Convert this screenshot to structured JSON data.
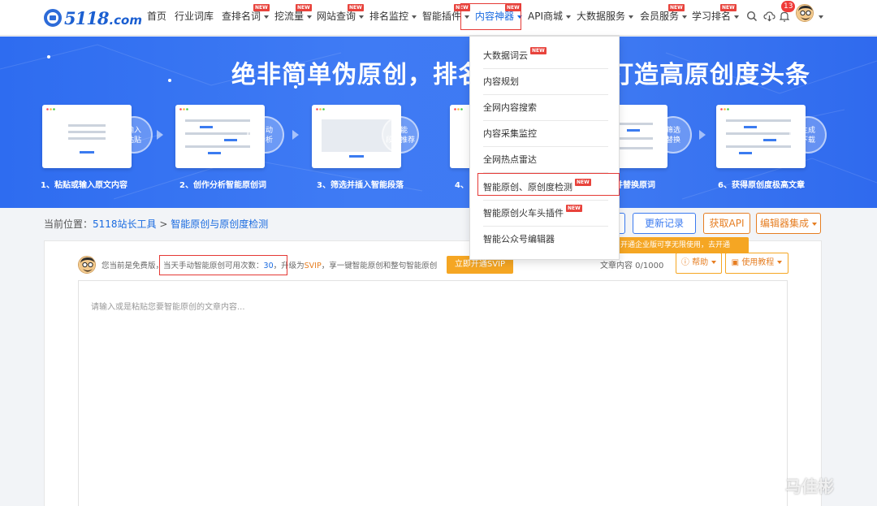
{
  "logo": {
    "text": "5118",
    "suffix": ".com"
  },
  "nav": {
    "items": [
      {
        "label": "首页"
      },
      {
        "label": "行业词库"
      },
      {
        "label": "查排名词",
        "new": "NEW"
      },
      {
        "label": "挖流量",
        "new": "NEW"
      },
      {
        "label": "网站查询",
        "new": "NEW"
      },
      {
        "label": "排名监控"
      },
      {
        "label": "智能插件",
        "new": "NEW"
      },
      {
        "label": "内容神器",
        "new": "NEW"
      },
      {
        "label": "API商城"
      },
      {
        "label": "大数据服务"
      },
      {
        "label": "会员服务",
        "new": "NEW"
      },
      {
        "label": "学习排名",
        "new": "NEW"
      }
    ],
    "notification_count": "13"
  },
  "banner": {
    "title": "绝非简单伪原创，排名利器，轻松打造高原创度头条",
    "steps": [
      {
        "label": "1、粘贴或输入原文内容",
        "circle": [
          "输入",
          "粘贴"
        ]
      },
      {
        "label": "2、创作分析智能原创词",
        "circle": [
          "自动",
          "分析"
        ]
      },
      {
        "label": "3、筛选并插入智能段落",
        "circle": [
          "智能",
          "段落推荐"
        ]
      },
      {
        "label": "4、",
        "circle": [
          "",
          ""
        ]
      },
      {
        "label": "5、筛选并替换原词",
        "circle": [
          "筛选",
          "替换"
        ]
      },
      {
        "label": "6、获得原创度极高文章",
        "circle": [
          "生成",
          "下载"
        ]
      }
    ]
  },
  "breadcrumb": {
    "prefix": "当前位置：",
    "root": "5118站长工具",
    "sep": ">",
    "current": "智能原创与原创度检测"
  },
  "actions": {
    "history": "更新记录",
    "api": "获取API",
    "editor": "编辑器集成"
  },
  "tooltip": "开通企业版可享无限使用，去开通",
  "info": {
    "free_text": "您当前是免费版，",
    "quota_label": "当天手动智能原创可用次数：",
    "quota_value": "30",
    "upgrade_prefix": "，升级为",
    "svip": "SVIP",
    "upgrade_suffix": "，享一键智能原创和整句智能原创",
    "upgrade_button": "立即开通SVIP",
    "wordcount": "文章内容 0/1000",
    "help": "帮助",
    "tutorial": "使用教程"
  },
  "editor": {
    "placeholder": "请输入或是粘贴您要智能原创的文章内容..."
  },
  "dropdown": {
    "items": [
      {
        "label": "大数据词云",
        "new": "NEW"
      },
      {
        "label": "内容规划"
      },
      {
        "label": "全网内容搜索"
      },
      {
        "label": "内容采集监控"
      },
      {
        "label": "全网热点雷达"
      },
      {
        "label": "智能原创、原创度检测",
        "new": "NEW"
      },
      {
        "label": "智能原创火车头插件",
        "new": "NEW"
      },
      {
        "label": "智能公众号编辑器"
      }
    ]
  },
  "watermark": "马佳彬",
  "colors": {
    "brand_blue": "#1a6be0",
    "banner_blue": "#3b78f1",
    "orange": "#f5a623",
    "highlight_red": "#e53935",
    "new_red": "#e8433c"
  }
}
